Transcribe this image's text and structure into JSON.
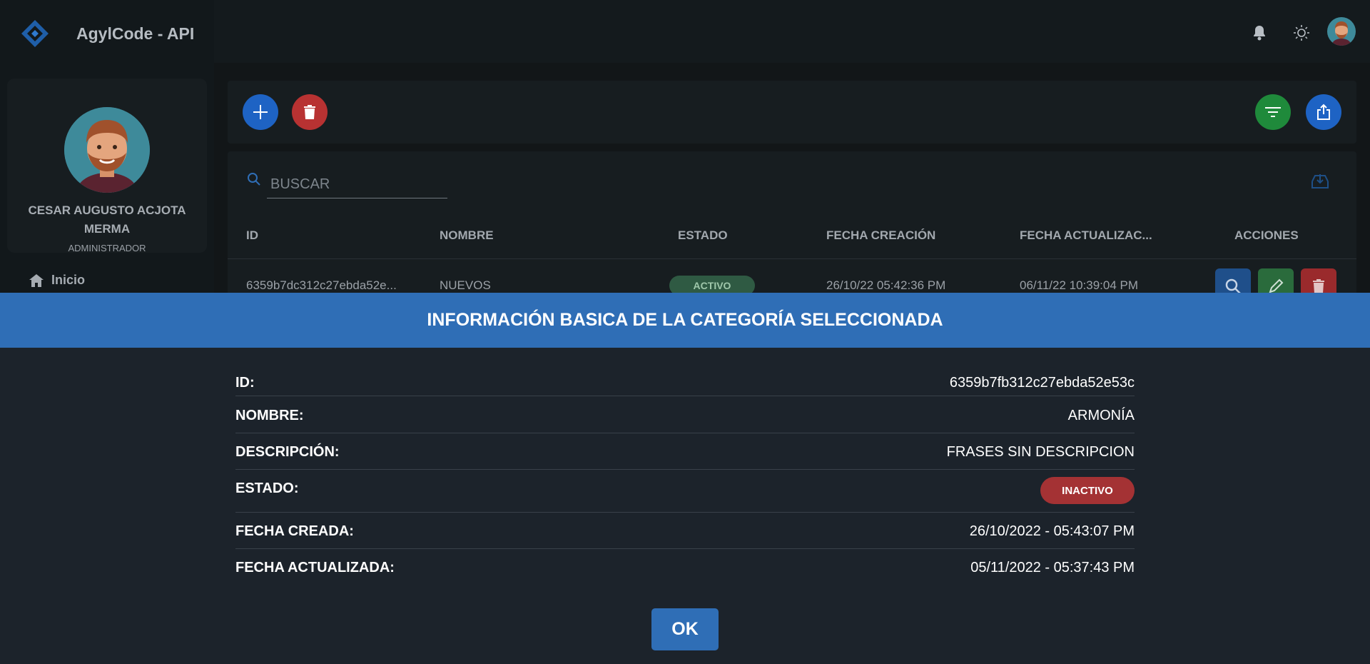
{
  "app": {
    "title": "AgylCode - API"
  },
  "topbar": {
    "icons": [
      "bell-icon",
      "brightness-icon",
      "user-avatar"
    ]
  },
  "sidebar": {
    "profile": {
      "name": "CESAR AUGUSTO ACJOTA MERMA",
      "role": "ADMINISTRADOR"
    },
    "items": [
      {
        "label": "Inicio",
        "icon": "home-icon"
      }
    ]
  },
  "toolbar": {
    "buttons": [
      "add-icon",
      "trash-icon",
      "filter-icon",
      "export-icon"
    ]
  },
  "search": {
    "placeholder": "BUSCAR"
  },
  "table": {
    "headers": [
      "ID",
      "NOMBRE",
      "ESTADO",
      "FECHA CREACIÓN",
      "FECHA ACTUALIZAC...",
      "ACCIONES"
    ],
    "rows": [
      {
        "id": "6359b7dc312c27ebda52e...",
        "nombre": "NUEVOS",
        "estado": "ACTIVO",
        "creacion": "26/10/22 05:42:36 PM",
        "actualizacion": "06/11/22 10:39:04 PM"
      }
    ]
  },
  "modal": {
    "title": "INFORMACIÓN BASICA DE LA CATEGORÍA SELECCIONADA",
    "fields": [
      {
        "label": "ID:",
        "value": "6359b7fb312c27ebda52e53c"
      },
      {
        "label": "NOMBRE:",
        "value": "ARMONÍA"
      },
      {
        "label": "DESCRIPCIÓN:",
        "value": "FRASES SIN DESCRIPCION"
      },
      {
        "label": "ESTADO:",
        "value": "INACTIVO"
      },
      {
        "label": "FECHA CREADA:",
        "value": "26/10/2022 - 05:43:07 PM"
      },
      {
        "label": "FECHA ACTUALIZADA:",
        "value": "05/11/2022 - 05:37:43 PM"
      }
    ],
    "ok_label": "OK"
  },
  "colors": {
    "primary": "#2f6eb6",
    "danger": "#a43234",
    "success": "#1f8a3b",
    "bg": "#121618"
  }
}
